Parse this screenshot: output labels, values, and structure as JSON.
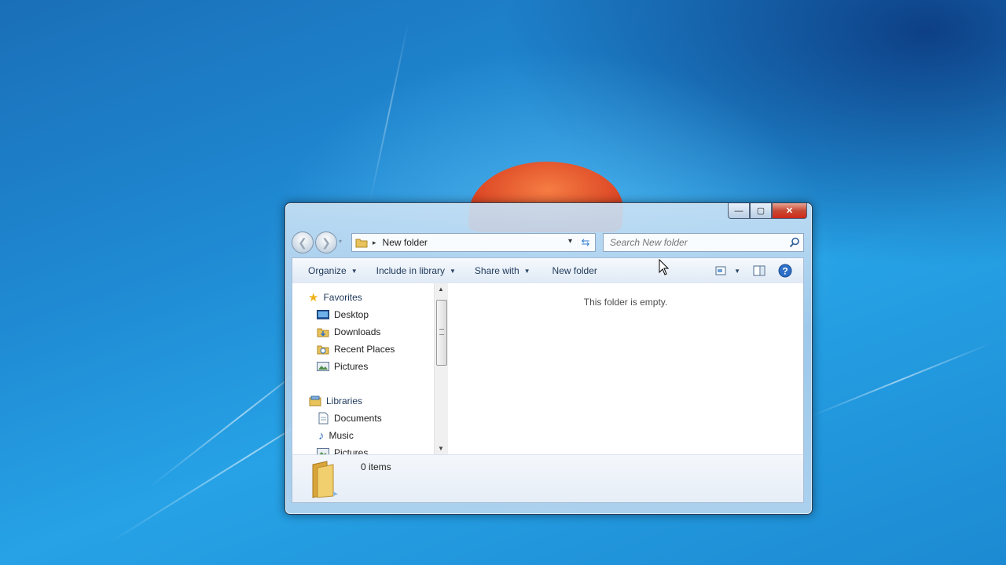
{
  "window": {
    "caption_buttons": {
      "minimize": "—",
      "maximize": "▢",
      "close": "✕"
    }
  },
  "nav": {
    "back_icon": "back-arrow-icon",
    "forward_icon": "forward-arrow-icon",
    "address": {
      "separator": "▸",
      "crumb": "New folder",
      "dropdown": "▾"
    },
    "refresh_icon": "refresh-icon",
    "search": {
      "placeholder": "Search New folder",
      "icon": "search-icon"
    }
  },
  "toolbar": {
    "organize": "Organize",
    "include_in_library": "Include in library",
    "share_with": "Share with",
    "new_folder": "New folder",
    "views_icon": "views-icon",
    "preview_pane_icon": "preview-pane-icon",
    "help_icon": "help-icon"
  },
  "sidebar": {
    "favorites": {
      "label": "Favorites",
      "items": [
        {
          "label": "Desktop"
        },
        {
          "label": "Downloads"
        },
        {
          "label": "Recent Places"
        },
        {
          "label": "Pictures"
        }
      ]
    },
    "libraries": {
      "label": "Libraries",
      "items": [
        {
          "label": "Documents"
        },
        {
          "label": "Music"
        },
        {
          "label": "Pictures"
        }
      ]
    }
  },
  "content": {
    "empty_message": "This folder is empty."
  },
  "details": {
    "item_count": "0 items"
  },
  "colors": {
    "accent": "#1e395b",
    "desktop": "#1f8ad3",
    "close_button": "#c74a34"
  }
}
